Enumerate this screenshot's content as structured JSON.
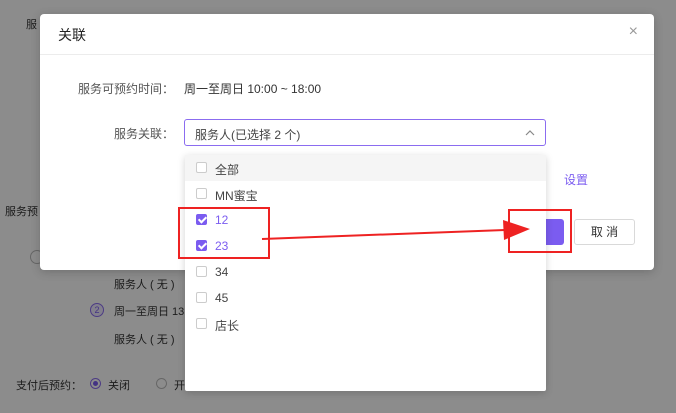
{
  "background": {
    "label_top": "服",
    "label_mid": "服务预",
    "service_person_1": "服务人 ( 无 )",
    "item_2_num": "2",
    "item_2_text": "周一至周日 13",
    "service_person_2": "服务人 ( 无 )",
    "pay_label": "支付后预约：",
    "pay_option_off": "关闭",
    "pay_option_on": "开"
  },
  "modal": {
    "title": "关联",
    "close_glyph": "×",
    "time_label": "服务可预约时间：",
    "time_value": "周一至周日 10:00 ~ 18:00",
    "assoc_label": "服务关联：",
    "select_value": "服务人(已选择 2 个)",
    "settings_link": "设置",
    "cancel_label": "取 消"
  },
  "dropdown": {
    "items": [
      {
        "label": "全部",
        "checked": false
      },
      {
        "label": "MN蜜宝",
        "checked": false
      },
      {
        "label": "12",
        "checked": true
      },
      {
        "label": "23",
        "checked": true
      },
      {
        "label": "34",
        "checked": false
      },
      {
        "label": "45",
        "checked": false
      },
      {
        "label": "店长",
        "checked": false
      }
    ]
  },
  "colors": {
    "accent": "#7b5cf0",
    "annotation": "#ee2222"
  }
}
